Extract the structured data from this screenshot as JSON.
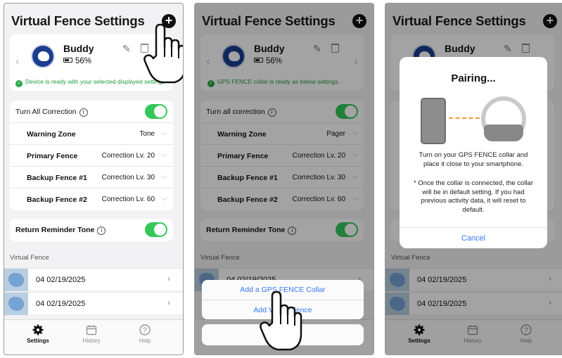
{
  "screen1": {
    "title": "Virtual Fence Settings",
    "add_icon": "plus-circle-icon",
    "pet": {
      "name": "Buddy",
      "battery": "56%"
    },
    "status": "Device is ready with your selected displayed settings",
    "correction": {
      "label": "Turn All Correction",
      "on": true
    },
    "rows": [
      {
        "label": "Warning Zone",
        "value": "Tone"
      },
      {
        "label": "Primary Fence",
        "value": "Correction Lv. 20"
      },
      {
        "label": "Backup Fence #1",
        "value": "Correction Lv. 30"
      },
      {
        "label": "Backup Fence #2",
        "value": "Correction Lv. 60"
      }
    ],
    "reminder": {
      "label": "Return Reminder Tone",
      "on": true
    },
    "section": "Virtual Fence",
    "fences": [
      "04 02/19/2025",
      "04 02/19/2025"
    ]
  },
  "screen2": {
    "title": "Virtual Fence Settings",
    "pet": {
      "name": "Buddy",
      "battery": "56%"
    },
    "status": "GPS FENCE collar is ready as below settings.",
    "correction": {
      "label": "Turn all correction",
      "on": true
    },
    "rows": [
      {
        "label": "Warning Zone",
        "value": "Pager"
      },
      {
        "label": "Primary Fence",
        "value": "Correction Lv. 20"
      },
      {
        "label": "Backup Fence #1",
        "value": "Correction Lv. 30"
      },
      {
        "label": "Backup Fence #2",
        "value": "Correction Lv. 60"
      }
    ],
    "reminder": {
      "label": "Return Reminder Tone",
      "on": true
    },
    "section": "Virtual Fence",
    "fences": [
      "04 02/19/2025"
    ],
    "sheet": {
      "option1": "Add a GPS FENCE Collar",
      "option2": "Add Virtual Fence"
    }
  },
  "screen3": {
    "title": "Virtual Fence Settings",
    "pet": {
      "name": "Buddy"
    },
    "section": "Virtual Fence",
    "fences": [
      "04 02/19/2025",
      "04 02/19/2025"
    ],
    "modal": {
      "title": "Pairing...",
      "instruction": "Turn on your GPS FENCE collar and place it close to your smartphone.",
      "note": "* Once the collar is connected, the collar will be in default setting. If you had previous activity data, it will reset to default.",
      "cancel": "Cancel"
    }
  },
  "tabs": [
    {
      "label": "Settings",
      "icon": "gear-icon",
      "active": true
    },
    {
      "label": "History",
      "icon": "calendar-icon",
      "active": false
    },
    {
      "label": "Help",
      "icon": "question-icon",
      "active": false
    }
  ],
  "colors": {
    "toggle_on": "#34c759",
    "link": "#3478f6",
    "status_green": "#1f9d3a",
    "avatar": "#1b3d8f"
  }
}
